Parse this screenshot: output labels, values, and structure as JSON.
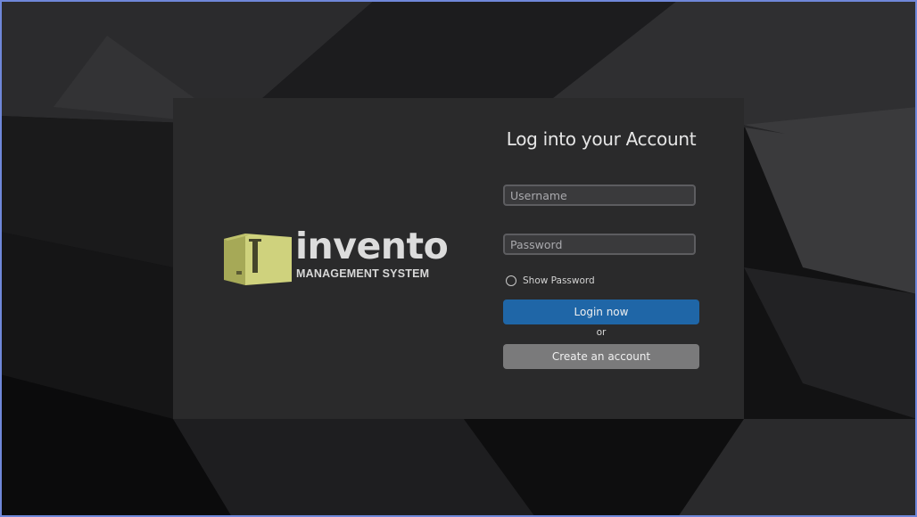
{
  "logo": {
    "word": "invento",
    "subtitle": "MANAGEMENT SYSTEM",
    "color": "#b8bb63"
  },
  "login": {
    "title": "Log into your Account",
    "username_placeholder": "Username",
    "username_value": "",
    "password_placeholder": "Password",
    "password_value": "",
    "show_password_label": "Show Password",
    "show_password_checked": false,
    "login_button": "Login now",
    "or_text": "or",
    "create_button": "Create an account"
  },
  "colors": {
    "card_bg": "#2a2a2b",
    "login_button": "#1f66a7",
    "create_button": "#7a7a7b",
    "field_bg": "#3a3a3c"
  }
}
